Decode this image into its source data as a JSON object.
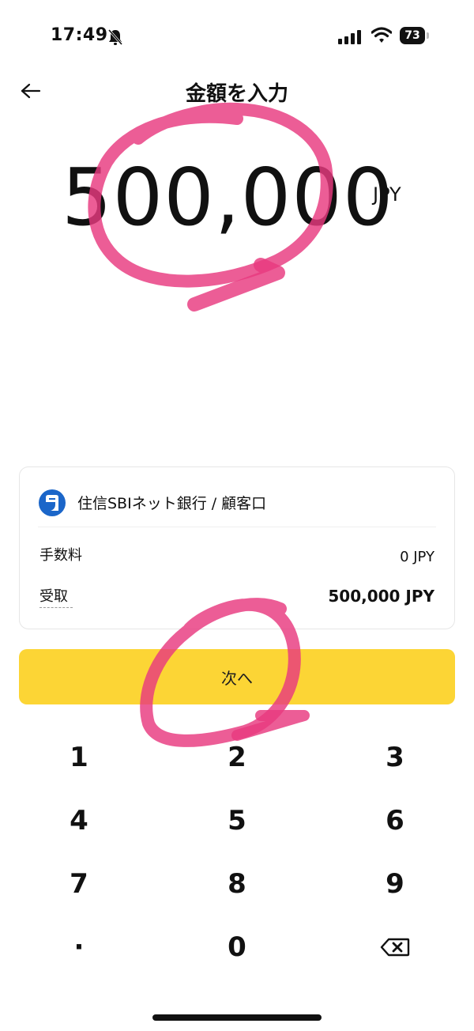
{
  "status_bar": {
    "time": "17:49",
    "battery": "73",
    "icons": [
      "bell-slash-icon",
      "cellular-signal-icon",
      "wifi-icon",
      "battery-icon"
    ]
  },
  "header": {
    "title": "金額を入力",
    "back_icon": "arrow-left-icon"
  },
  "amount": {
    "value": "500,000",
    "currency": "JPY"
  },
  "summary_card": {
    "bank_name": "住信SBIネット銀行 / 顧客口",
    "fee_label": "手数料",
    "fee_value": "0 JPY",
    "receive_label": "受取",
    "receive_value": "500,000 JPY"
  },
  "next_button": {
    "label": "次へ",
    "color": "#fcd535"
  },
  "keypad": {
    "keys": [
      "1",
      "2",
      "3",
      "4",
      "5",
      "6",
      "7",
      "8",
      "9",
      "·",
      "0"
    ],
    "backspace_icon": "backspace-icon"
  },
  "annotation_color": "#e8397f"
}
